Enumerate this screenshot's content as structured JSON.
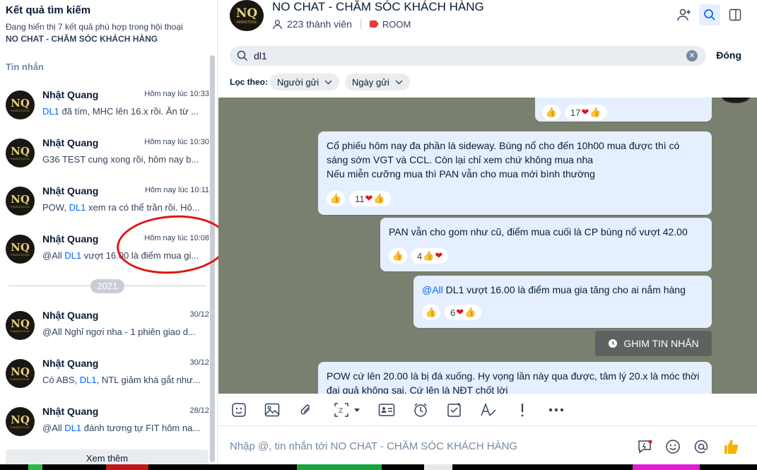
{
  "left": {
    "title": "Kết quả tìm kiếm",
    "subtitle": "Đang hiển thị 7 kết quả phù hợp trong hội thoại",
    "conversation": "NO CHAT - CHĂM SÓC KHÁCH HÀNG",
    "section": "Tin nhắn",
    "year": "2021",
    "more": "Xem thêm",
    "results": [
      {
        "name": "Nhật Quang",
        "time": "Hôm nay lúc 10:33",
        "pre": "",
        "hl": "DL1",
        "post": " đã tím, MHC lên 16.x rồi. Ăn từ ..."
      },
      {
        "name": "Nhật Quang",
        "time": "Hôm nay lúc 10:30",
        "pre": "G36 TEST cung xong rồi, hôm nay b...",
        "hl": "",
        "post": ""
      },
      {
        "name": "Nhật Quang",
        "time": "Hôm nay lúc 10:11",
        "pre": "POW, ",
        "hl": "DL1",
        "post": " xem ra có thể trần rồi. Hô..."
      },
      {
        "name": "Nhật Quang",
        "time": "Hôm nay lúc 10:08",
        "pre": "@All ",
        "hl": "DL1",
        "post": " vượt 16.00 là điểm mua gi..."
      },
      {
        "name": "Nhật Quang",
        "time": "30/12",
        "pre": "@All Nghỉ ngơi nha - 1 phiên giao d...",
        "hl": "",
        "post": ""
      },
      {
        "name": "Nhật Quang",
        "time": "30/12",
        "pre": "Có ABS, ",
        "hl": "DL1",
        "post": ", NTL giảm khá gắt như..."
      },
      {
        "name": "Nhật Quang",
        "time": "28/12",
        "pre": "@All ",
        "hl": "DL1",
        "post": " đánh tương tự FIT hôm na..."
      }
    ]
  },
  "avatar": {
    "mark": "NQ",
    "sub": "FINDSTOCK"
  },
  "header": {
    "title": "NO CHAT - CHĂM SÓC KHÁCH HÀNG",
    "members": "223 thành viên",
    "room": "ROOM"
  },
  "search": {
    "value": "dl1",
    "close": "Đóng",
    "filter_label": "Lọc theo:",
    "filter_sender": "Người gửi",
    "filter_date": "Ngày gửi"
  },
  "chat": {
    "r0": "17",
    "m1": "Cổ phiếu hôm nay đa phần là sideway. Bùng nổ cho đến 10h00 mua được thì có sáng sớm VGT và CCL. Còn lại chỉ xem chứ không mua nha",
    "m1b": "Nếu miễn cưỡng mua thì PAN vẫn cho mua mới bình thường",
    "r1": "11",
    "m2": "PAN vẫn cho gom như cũ, điểm mua cuối là CP bùng nổ vượt 42.00",
    "r2": "4",
    "m3_mention": "@All",
    "m3": " DL1  vượt 16.00 là điểm mua gia tăng cho ai nắm hàng",
    "r3": "6",
    "pin": "GHIM TIN NHẮN",
    "m4": "POW cứ lên 20.00 là bị đá xuống. Hy vọng lần này qua được, tâm lý 20.x là móc thời đại quả không sai. Cứ lên là NĐT chốt lời"
  },
  "input": {
    "placeholder": "Nhập @, tin nhắn tới NO CHAT - CHĂM SÓC KHÁCH HÀNG"
  },
  "colors": {
    "accent": "#0068ff",
    "bubble": "#e5efff",
    "chat_bg": "#7a806f",
    "annotation": "#e0151b"
  }
}
